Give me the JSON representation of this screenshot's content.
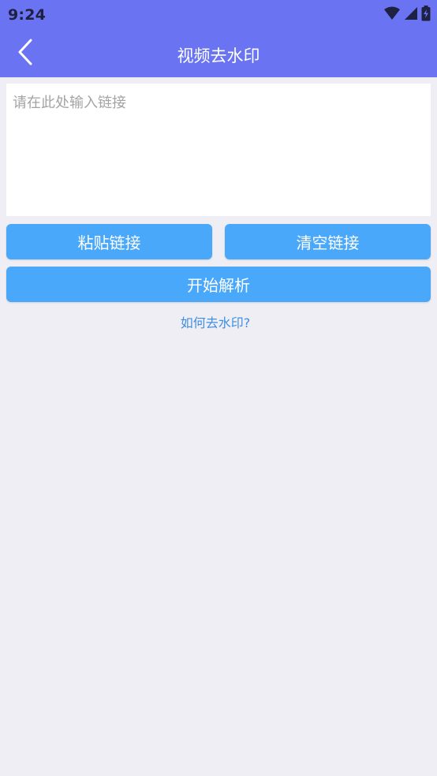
{
  "status_bar": {
    "time": "9:24",
    "icons": [
      "wifi-icon",
      "cell-signal-icon",
      "battery-charging-icon"
    ]
  },
  "app_bar": {
    "title": "视频去水印",
    "back_icon": "chevron-left-icon"
  },
  "link_input": {
    "placeholder": "请在此处输入链接",
    "value": ""
  },
  "buttons": {
    "paste": "粘贴链接",
    "clear": "清空链接",
    "parse": "开始解析"
  },
  "help_link": "如何去水印?",
  "colors": {
    "header": "#6a74f2",
    "button": "#4aa8fb",
    "background": "#efeef4",
    "link": "#3e8fe0"
  }
}
